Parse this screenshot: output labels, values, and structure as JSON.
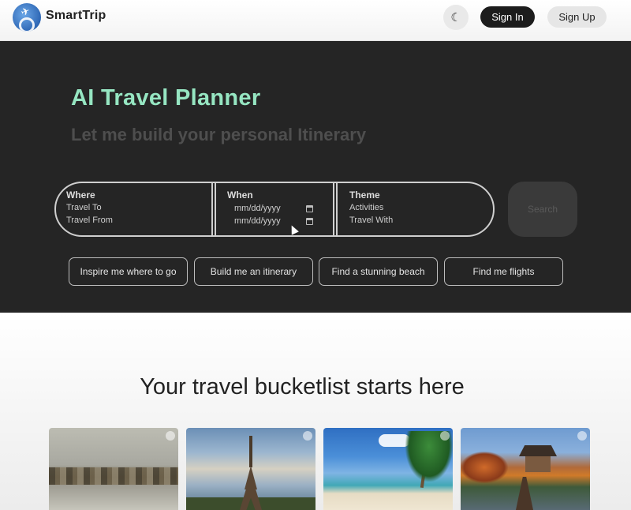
{
  "header": {
    "brand": "SmartTrip",
    "theme_toggle_icon": "moon-sparkle-icon",
    "sign_in_label": "Sign In",
    "sign_up_label": "Sign Up"
  },
  "hero": {
    "title": "AI Travel Planner",
    "subtitle": "Let me build your personal Itinerary",
    "where": {
      "label": "Where",
      "travel_to_placeholder": "Travel To",
      "travel_from_placeholder": "Travel From"
    },
    "when": {
      "label": "When",
      "start_date_placeholder": "mm/dd/yyyy",
      "end_date_placeholder": "mm/dd/yyyy"
    },
    "theme": {
      "label": "Theme",
      "activities_placeholder": "Activities",
      "travel_with_placeholder": "Travel With"
    },
    "search_label": "Search",
    "chips": [
      "Inspire me where to go",
      "Build me an itinerary",
      "Find a stunning beach",
      "Find me flights"
    ]
  },
  "bucketlist": {
    "title": "Your travel bucketlist starts here",
    "cards": [
      "boats-harbor-photo",
      "eiffel-tower-photo",
      "tropical-beach-photo",
      "korean-pavilion-photo"
    ]
  },
  "colors": {
    "accent": "#96e6c2",
    "hero_bg": "#252525",
    "signin_bg": "#1c1c1c"
  }
}
